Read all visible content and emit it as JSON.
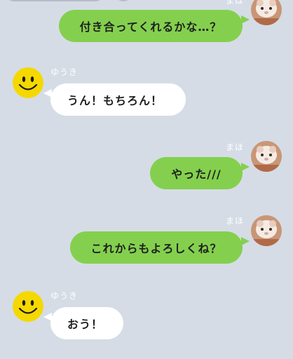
{
  "messages": [
    {
      "sender": "まほ",
      "side": "right",
      "text": "付き合ってくれるかな…？",
      "avatar_icon": "hamster-photo-icon"
    },
    {
      "sender": "ゆうき",
      "side": "left",
      "text": "うん！もちろん！",
      "avatar_icon": "smiley-icon"
    },
    {
      "sender": "まほ",
      "side": "right",
      "text": "やった///",
      "avatar_icon": "hamster-photo-icon"
    },
    {
      "sender": "まほ",
      "side": "right",
      "text": "これからもよろしくね？",
      "avatar_icon": "hamster-photo-icon"
    },
    {
      "sender": "ゆうき",
      "side": "left",
      "text": "おう！",
      "avatar_icon": "smiley-icon"
    }
  ],
  "colors": {
    "background": "#d5dce6",
    "my_bubble": "#84d04e",
    "their_bubble": "#ffffff",
    "smiley": "#f5d800"
  }
}
